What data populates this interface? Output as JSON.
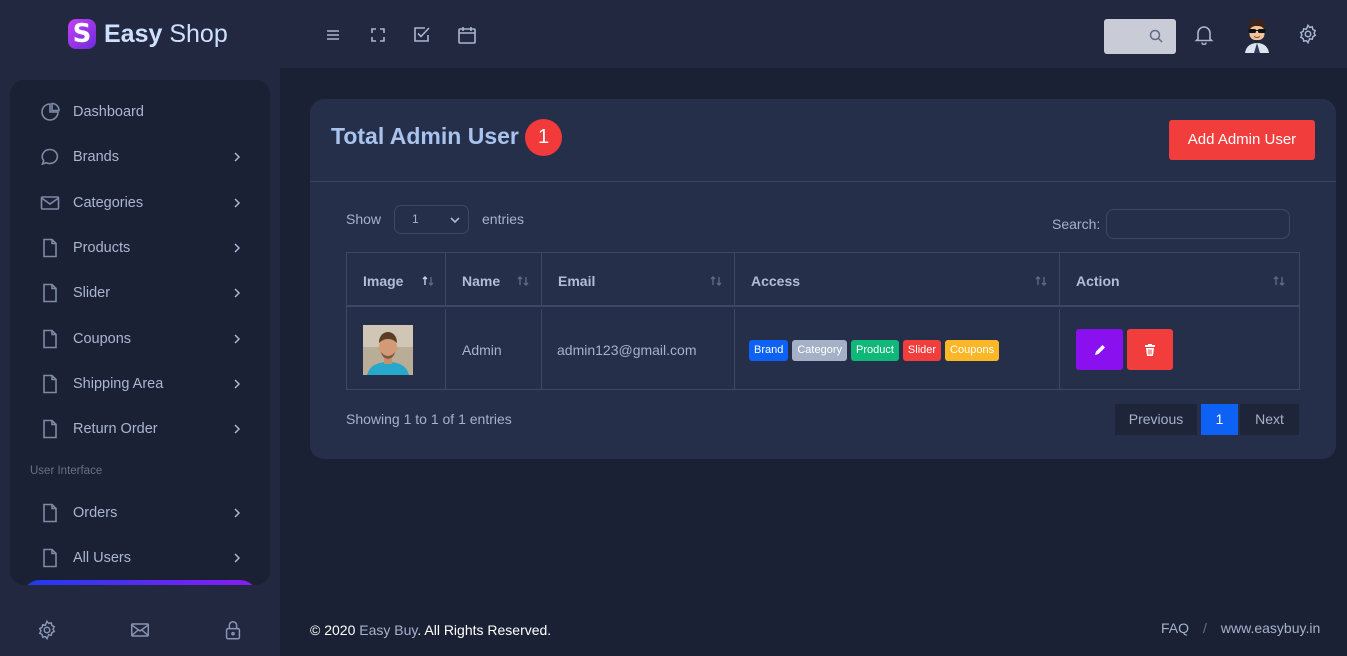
{
  "brand": {
    "name_bold": "Easy",
    "name_rest": " Shop",
    "logo_letter": "S"
  },
  "sidebar": {
    "items": [
      {
        "label": "Dashboard",
        "icon": "pie-chart-icon",
        "has_children": false
      },
      {
        "label": "Brands",
        "icon": "chat-bubble-icon",
        "has_children": true
      },
      {
        "label": "Categories",
        "icon": "mail-icon",
        "has_children": true
      },
      {
        "label": "Products",
        "icon": "file-icon",
        "has_children": true
      },
      {
        "label": "Slider",
        "icon": "file-icon",
        "has_children": true
      },
      {
        "label": "Coupons",
        "icon": "file-icon",
        "has_children": true
      },
      {
        "label": "Shipping Area",
        "icon": "file-icon",
        "has_children": true
      },
      {
        "label": "Return Order",
        "icon": "file-icon",
        "has_children": true
      },
      {
        "label": "Orders",
        "icon": "file-icon",
        "has_children": true
      },
      {
        "label": "All Users",
        "icon": "file-icon",
        "has_children": true
      }
    ],
    "section_label": "User Interface",
    "footer_icons": [
      "settings-icon",
      "mail-icon",
      "lock-icon"
    ]
  },
  "topbar": {
    "icons": [
      "menu-icon",
      "fullscreen-icon",
      "checkbox-icon",
      "calendar-icon"
    ],
    "right_icons": [
      "search-icon",
      "bell-icon",
      "avatar",
      "settings-icon"
    ]
  },
  "page": {
    "title": "Total Admin User",
    "count": "1",
    "add_button": "Add Admin User"
  },
  "table_controls": {
    "show_label": "Show",
    "entries_value": "1",
    "entries_label": "entries",
    "search_label": "Search:"
  },
  "table": {
    "columns": [
      "Image",
      "Name",
      "Email",
      "Access",
      "Action"
    ],
    "rows": [
      {
        "name": "Admin",
        "email": "admin123@gmail.com",
        "access": [
          {
            "label": "Brand",
            "color": "#0d62f5"
          },
          {
            "label": "Category",
            "color": "#a3b0c6"
          },
          {
            "label": "Product",
            "color": "#0fb879"
          },
          {
            "label": "Slider",
            "color": "#f23d3d"
          },
          {
            "label": "Coupons",
            "color": "#fcb727"
          }
        ]
      }
    ],
    "info": "Showing 1 to 1 of 1 entries",
    "pagination": {
      "previous": "Previous",
      "current": "1",
      "next": "Next"
    }
  },
  "footer": {
    "copyright_prefix": "© 2020 ",
    "copyright_brand": "Easy Buy",
    "copyright_suffix": ". All Rights Reserved.",
    "link_faq": "FAQ",
    "separator": "/",
    "link_site": "www.easybuy.in"
  },
  "colors": {
    "accent_red": "#f23d3d",
    "accent_blue": "#0d62f5",
    "accent_purple": "#8b10f0"
  }
}
